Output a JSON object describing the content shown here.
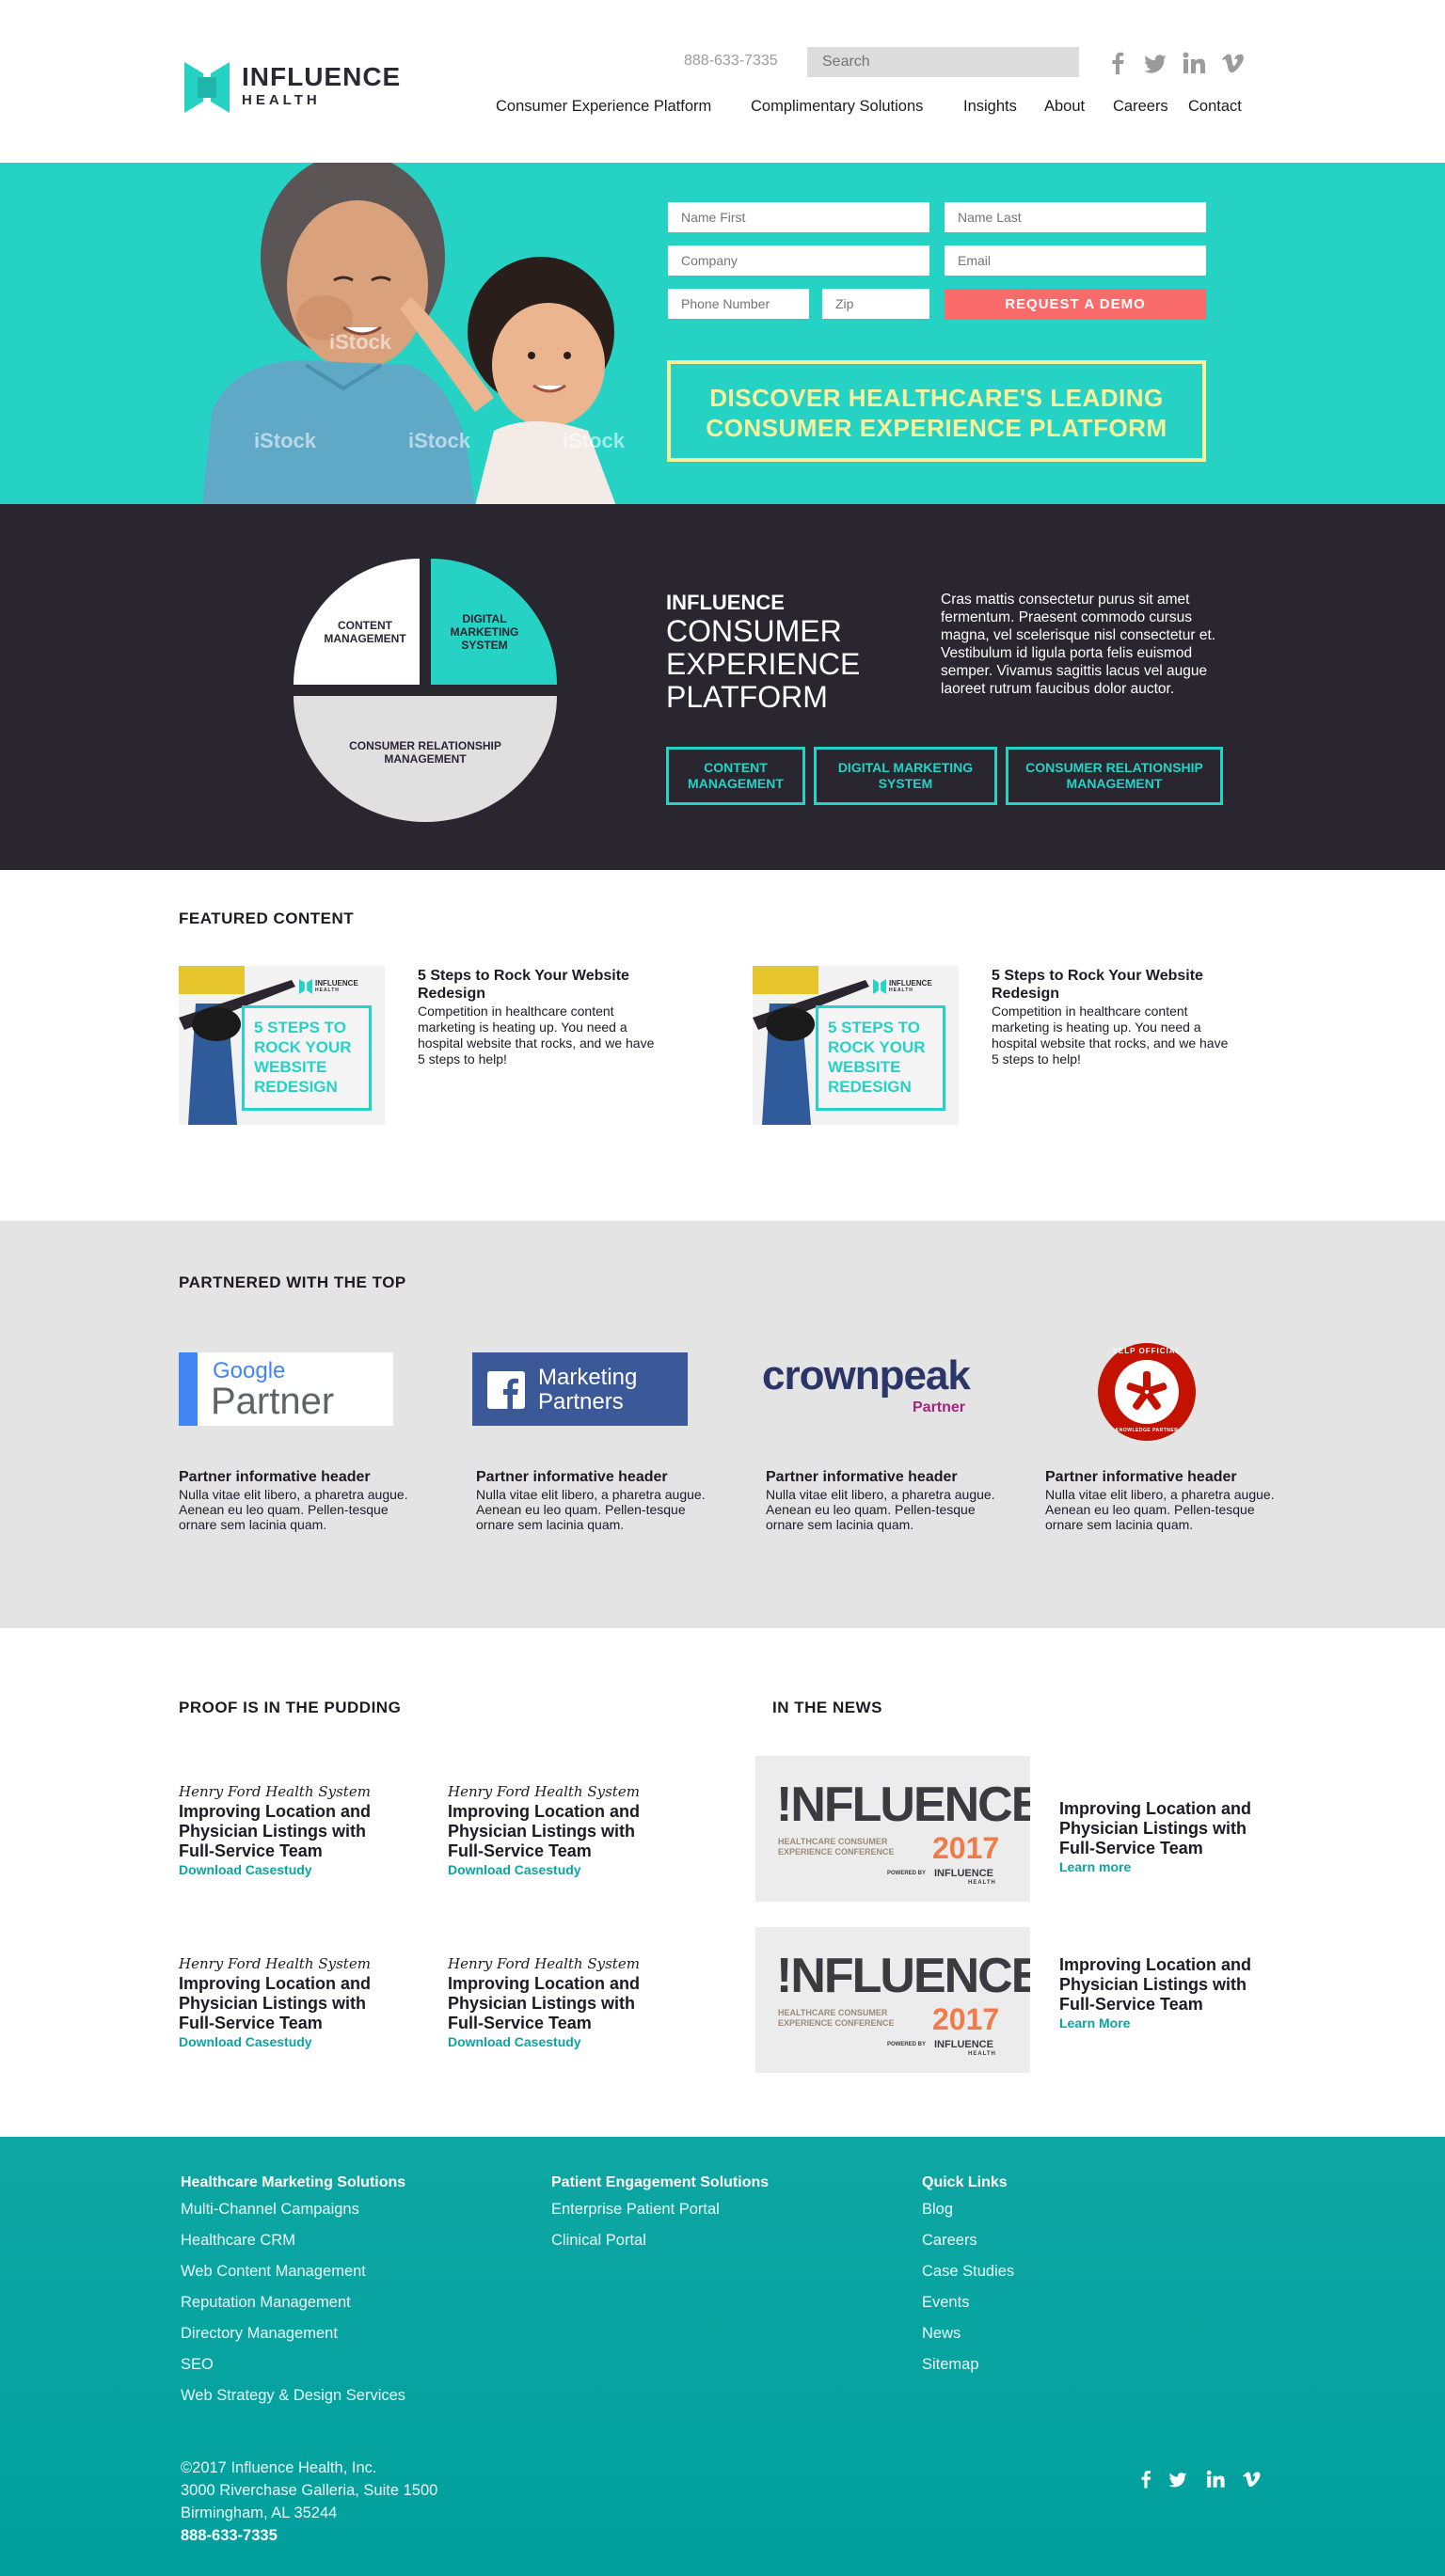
{
  "header": {
    "logo_line1": "INFLUENCE",
    "logo_line2": "HEALTH",
    "phone": "888-633-7335",
    "search_placeholder": "Search",
    "social_icons": [
      "facebook-icon",
      "twitter-icon",
      "linkedin-icon",
      "vimeo-icon"
    ],
    "nav": [
      "Consumer Experience Platform",
      "Complimentary Solutions",
      "Insights",
      "About",
      "Careers",
      "Contact"
    ]
  },
  "hero": {
    "form": {
      "first_name": "Name First",
      "last_name": "Name Last",
      "company": "Company",
      "email": "Email",
      "phone": "Phone Number",
      "zip": "Zip",
      "button": "REQUEST A DEMO"
    },
    "watermark": "iStock",
    "headline_line1": "DISCOVER HEALTHCARE'S LEADING",
    "headline_line2": "CONSUMER EXPERIENCE PLATFORM"
  },
  "platform": {
    "pie": {
      "content": [
        "CONTENT",
        "MANAGEMENT"
      ],
      "digital": [
        "DIGITAL",
        "MARKETING",
        "SYSTEM"
      ],
      "crm": [
        "CONSUMER RELATIONSHIP",
        "MANAGEMENT"
      ]
    },
    "heading_small": "INFLUENCE",
    "heading_line1": "CONSUMER",
    "heading_line2": "EXPERIENCE",
    "heading_line3": "PLATFORM",
    "body": "Cras mattis consectetur purus sit amet fermentum. Praesent commodo cursus magna, vel scelerisque nisl consectetur et. Vestibulum id ligula porta felis euismod semper. Vivamus sagittis lacus vel augue laoreet rutrum faucibus dolor auctor.",
    "buttons": [
      [
        "CONTENT",
        "MANAGEMENT"
      ],
      [
        "DIGITAL MARKETING",
        "SYSTEM"
      ],
      [
        "CONSUMER RELATIONSHIP",
        "MANAGEMENT"
      ]
    ]
  },
  "featured": {
    "title": "FEATURED CONTENT",
    "items": [
      {
        "img_brand_1": "INFLUENCE",
        "img_brand_2": "HEALTH",
        "img_text": [
          "5 STEPS TO",
          "ROCK YOUR",
          "WEBSITE",
          "REDESIGN"
        ],
        "title": "5 Steps to Rock Your Website Redesign",
        "desc": "Competition in healthcare content marketing is heating up. You need a hospital website that rocks, and we have 5 steps to help!"
      },
      {
        "img_brand_1": "INFLUENCE",
        "img_brand_2": "HEALTH",
        "img_text": [
          "5 STEPS TO",
          "ROCK YOUR",
          "WEBSITE",
          "REDESIGN"
        ],
        "title": "5 Steps to Rock Your Website Redesign",
        "desc": "Competition in healthcare content marketing is heating up. You need a hospital website that rocks, and we have 5 steps to help!"
      }
    ]
  },
  "partners": {
    "title": "PARTNERED WITH THE TOP",
    "logos": {
      "google_1": "Google",
      "google_2": "Partner",
      "fb_1": "Marketing",
      "fb_2": "Partners",
      "crownpeak_1": "crownpeak",
      "crownpeak_2": "Partner",
      "yelp_top": "YELP OFFICIAL",
      "yelp_bottom": "KNOWLEDGE PARTNER"
    },
    "items": [
      {
        "header": "Partner informative header",
        "desc": "Nulla vitae elit libero, a pharetra augue. Aenean eu leo quam. Pellen-tesque ornare sem lacinia quam."
      },
      {
        "header": "Partner informative header",
        "desc": "Nulla vitae elit libero, a pharetra augue. Aenean eu leo quam. Pellen-tesque ornare sem lacinia quam."
      },
      {
        "header": "Partner informative header",
        "desc": "Nulla vitae elit libero, a pharetra augue. Aenean eu leo quam. Pellen-tesque ornare sem lacinia quam."
      },
      {
        "header": "Partner informative header",
        "desc": "Nulla vitae elit libero, a pharetra augue. Aenean eu leo quam. Pellen-tesque ornare sem lacinia quam."
      }
    ]
  },
  "proof": {
    "title": "PROOF IS IN THE PUDDING",
    "cases": [
      {
        "org": "Henry Ford Health System",
        "title": "Improving Location and Physician Listings with Full-Service Team",
        "link": "Download Casestudy"
      },
      {
        "org": "Henry Ford Health System",
        "title": "Improving Location and Physician Listings with Full-Service Team",
        "link": "Download Casestudy"
      },
      {
        "org": "Henry Ford Health System",
        "title": "Improving Location and Physician Listings with Full-Service Team",
        "link": "Download Casestudy"
      },
      {
        "org": "Henry Ford Health System",
        "title": "Improving Location and Physician Listings with Full-Service Team",
        "link": "Download Casestudy"
      }
    ]
  },
  "news": {
    "title": "IN THE NEWS",
    "image": {
      "brand": "!NFLUENCE",
      "sub1": "HEALTHCARE CONSUMER",
      "sub2": "EXPERIENCE CONFERENCE",
      "year": "2017",
      "powered": "POWERED BY",
      "brand_small_1": "INFLUENCE",
      "brand_small_2": "HEALTH"
    },
    "items": [
      {
        "title": "Improving Location and Physician Listings with Full-Service Team",
        "link": "Learn more"
      },
      {
        "title": "Improving Location and Physician Listings with Full-Service Team",
        "link": "Learn More"
      }
    ]
  },
  "footer": {
    "col1": {
      "heading": "Healthcare Marketing Solutions",
      "links": [
        "Multi-Channel Campaigns",
        "Healthcare CRM",
        "Web Content Management",
        "Reputation Management",
        "Directory Management",
        "SEO",
        "Web Strategy & Design Services"
      ]
    },
    "col2": {
      "heading": "Patient Engagement Solutions",
      "links": [
        "Enterprise Patient Portal",
        "Clinical Portal"
      ]
    },
    "col3": {
      "heading": "Quick Links",
      "links": [
        "Blog",
        "Careers",
        "Case Studies",
        "Events",
        "News",
        "Sitemap"
      ]
    },
    "copyright": "©2017 Influence Health, Inc.",
    "address1": "3000 Riverchase Galleria, Suite 1500",
    "address2": "Birmingham, AL 35244",
    "phone": "888-633-7335",
    "social_icons": [
      "facebook-icon",
      "twitter-icon",
      "linkedin-icon",
      "vimeo-icon"
    ]
  },
  "colors": {
    "teal": "#26d2c4",
    "dark": "#2a2630",
    "coral": "#f96b6b",
    "yellow": "#f6f39b",
    "footer_teal": "#00a09d"
  }
}
